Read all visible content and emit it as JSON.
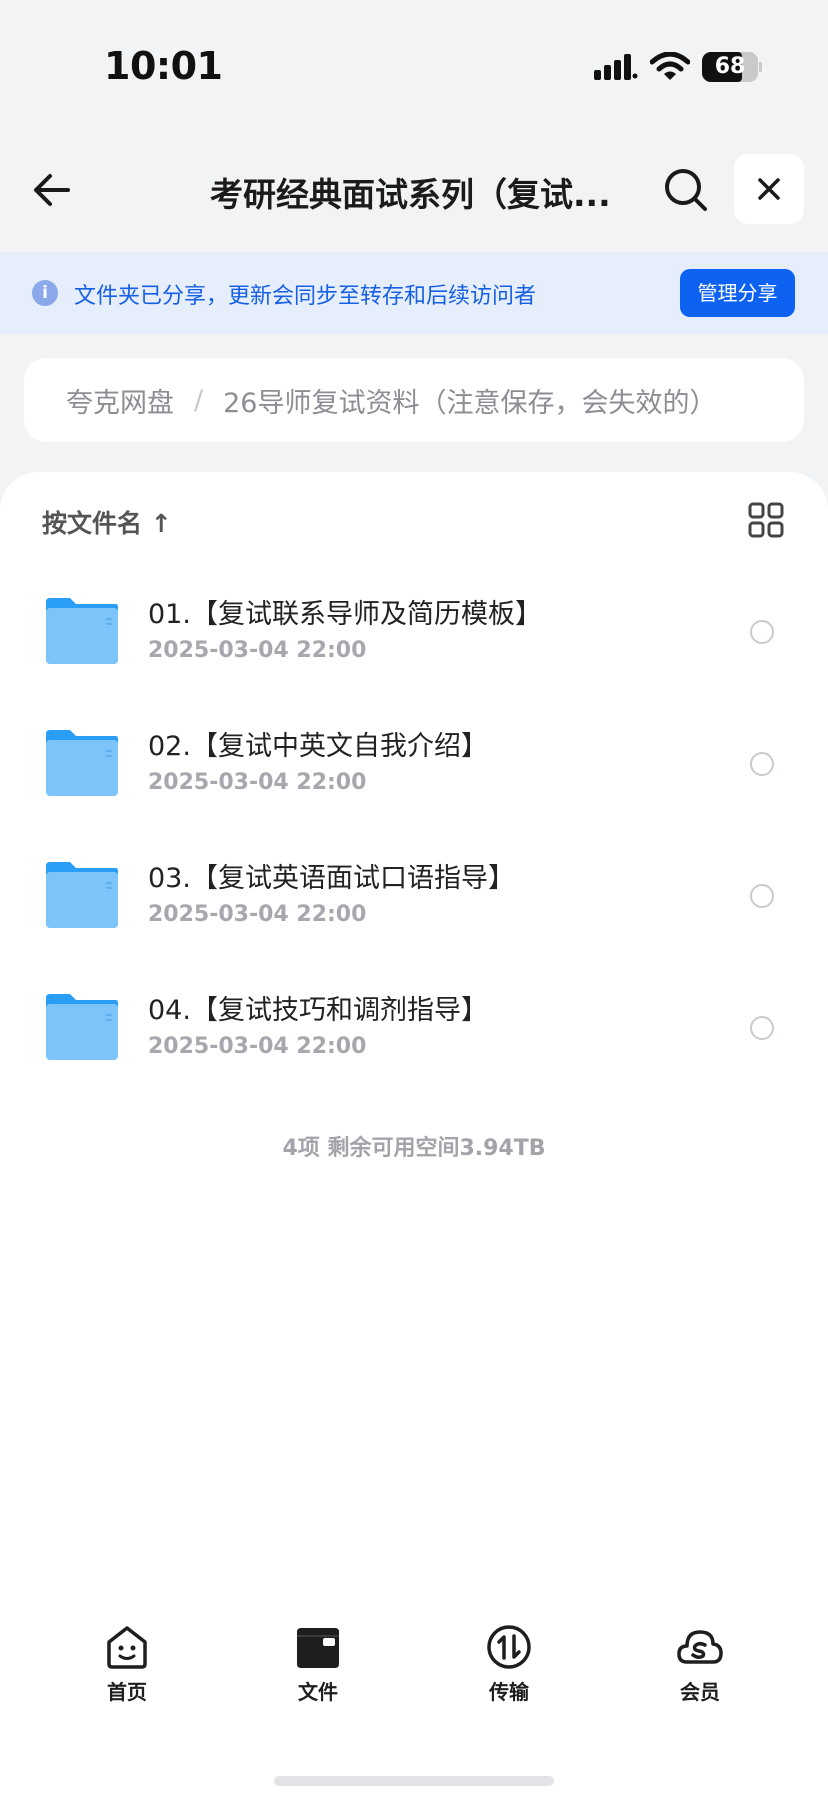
{
  "status_bar": {
    "time": "10:01",
    "battery": "68"
  },
  "nav": {
    "title": "考研经典面试系列（复试...",
    "back_icon": "back-arrow-icon",
    "search_icon": "search-icon",
    "close_icon": "close-icon"
  },
  "banner": {
    "text": "文件夹已分享，更新会同步至转存和后续访问者",
    "button_label": "管理分享",
    "accent": "#0e62f2"
  },
  "breadcrumb": {
    "root": "夸克网盘",
    "separator": "/",
    "current": "26导师复试资料（注意保存，会失效的）"
  },
  "sort": {
    "label": "按文件名 ↑"
  },
  "files": [
    {
      "name": "01.【复试联系导师及简历模板】",
      "date": "2025-03-04 22:00"
    },
    {
      "name": "02.【复试中英文自我介绍】",
      "date": "2025-03-04 22:00"
    },
    {
      "name": "03.【复试英语面试口语指导】",
      "date": "2025-03-04 22:00"
    },
    {
      "name": "04.【复试技巧和调剂指导】",
      "date": "2025-03-04 22:00"
    }
  ],
  "summary": "4项 剩余可用空间3.94TB",
  "tabs": [
    {
      "label": "首页",
      "icon": "home-face-icon"
    },
    {
      "label": "文件",
      "icon": "folder-tab-icon"
    },
    {
      "label": "传输",
      "icon": "transfer-icon"
    },
    {
      "label": "会员",
      "icon": "member-cloud-icon"
    }
  ]
}
